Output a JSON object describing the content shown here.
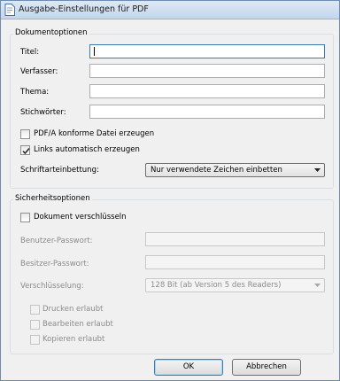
{
  "window": {
    "title": "Ausgabe-Einstellungen für PDF",
    "icon": "document-icon"
  },
  "document_options": {
    "group_title": "Dokumentoptionen",
    "fields": [
      {
        "label": "Titel:",
        "value": ""
      },
      {
        "label": "Verfasser:",
        "value": ""
      },
      {
        "label": "Thema:",
        "value": ""
      },
      {
        "label": "Stichwörter:",
        "value": ""
      }
    ],
    "pdfa": {
      "label": "PDF/A konforme Datei erzeugen",
      "checked": false
    },
    "links": {
      "label": "Links automatisch erzeugen",
      "checked": true
    },
    "embedding": {
      "label": "Schriftarteinbettung:",
      "value": "Nur verwendete Zeichen einbetten"
    }
  },
  "security_options": {
    "group_title": "Sicherheitsoptionen",
    "encrypt": {
      "label": "Dokument verschlüsseln",
      "checked": false
    },
    "user_password": {
      "label": "Benutzer-Passwort:",
      "value": ""
    },
    "owner_password": {
      "label": "Besitzer-Passwort:",
      "value": ""
    },
    "encryption": {
      "label": "Verschlüsselung:",
      "value": "128 Bit (ab Version 5 des Readers)"
    },
    "print": {
      "label": "Drucken erlaubt",
      "checked": false
    },
    "edit": {
      "label": "Bearbeiten erlaubt",
      "checked": false
    },
    "copy": {
      "label": "Kopieren erlaubt",
      "checked": false
    }
  },
  "buttons": {
    "ok": "OK",
    "cancel": "Abbrechen"
  }
}
